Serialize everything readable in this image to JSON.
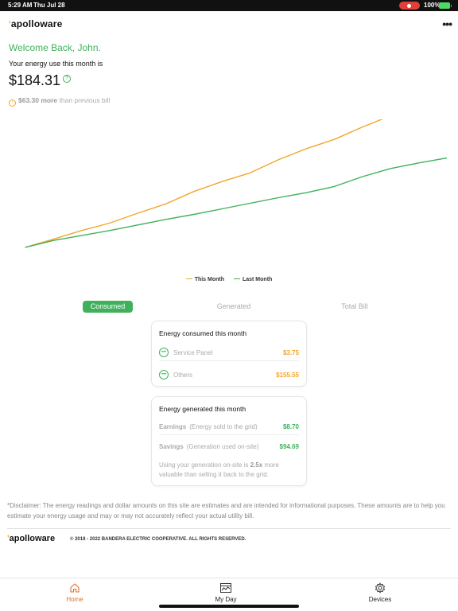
{
  "status_bar": {
    "time": "5:29 AM",
    "date": "Thu Jul 28",
    "battery": "100%"
  },
  "header": {
    "logo": "apolloware",
    "menu": "•••"
  },
  "summary": {
    "welcome": "Welcome Back, John.",
    "energy_label": "Your energy use this month is",
    "amount": "$184.31",
    "help": "?",
    "compare_amount": "$63.30 more",
    "compare_text": "than previous bill"
  },
  "colors": {
    "this_month": "#f2a62c",
    "last_month": "#3fb15a",
    "accent": "#3fb15a",
    "active_nav": "#e0722c"
  },
  "chart_data": {
    "type": "line",
    "title": "",
    "xlabel": "",
    "ylabel": "",
    "grid": false,
    "legend": "bottom",
    "xlim": [
      0,
      31
    ],
    "ylim": [
      0,
      200
    ],
    "series": [
      {
        "name": "This Month",
        "color": "#f2a62c",
        "x": [
          1,
          3,
          5,
          7,
          9,
          11,
          13,
          15,
          17,
          19,
          21,
          23,
          25,
          27,
          28
        ],
        "values": [
          4,
          17,
          31,
          43,
          59,
          74,
          94,
          110,
          124,
          145,
          163,
          178,
          198,
          216,
          216
        ]
      },
      {
        "name": "Last Month",
        "color": "#3fb15a",
        "x": [
          1,
          3,
          5,
          7,
          9,
          11,
          13,
          15,
          17,
          19,
          21,
          23,
          25,
          27,
          29,
          31
        ],
        "values": [
          4,
          15,
          23,
          31,
          40,
          49,
          57,
          66,
          75,
          84,
          92,
          102,
          118,
          131,
          140,
          148
        ]
      }
    ]
  },
  "legend": {
    "this_month": "This Month",
    "last_month": "Last Month"
  },
  "tabs": [
    {
      "label": "Consumed",
      "active": true
    },
    {
      "label": "Generated",
      "active": false
    },
    {
      "label": "Total Bill",
      "active": false
    }
  ],
  "consumed_card": {
    "title": "Energy consumed this month",
    "rows": [
      {
        "label": "Service Panel",
        "value": "$3.75"
      },
      {
        "label": "Others",
        "value": "$155.55"
      }
    ]
  },
  "generated_card": {
    "title": "Energy generated this month",
    "rows": [
      {
        "label": "Earnings",
        "sub": "(Energy sold to the grid)",
        "value": "$8.70"
      },
      {
        "label": "Savings",
        "sub": "(Generation used on-site)",
        "value": "$94.69"
      }
    ],
    "note_prefix": "Using your generation on-site is",
    "note_multiplier": "2.5x",
    "note_suffix": "more valuable than selling it back to the grid."
  },
  "disclaimer": "*Disclaimer: The energy readings and dollar amounts on this site are estimates and are intended for informational purposes. These amounts are to help you estimate your energy usage and may or may not accurately reflect your actual utility bill.",
  "footer": {
    "logo": "apolloware",
    "copyright": "© 2018 - 2022 BANDERA ELECTRIC COOPERATIVE. ALL RIGHTS RESERVED."
  },
  "bottom_nav": [
    {
      "label": "Home",
      "icon": "home-icon",
      "active": true
    },
    {
      "label": "My Day",
      "icon": "calendar-chart-icon",
      "active": false
    },
    {
      "label": "Devices",
      "icon": "gear-icon",
      "active": false
    }
  ]
}
